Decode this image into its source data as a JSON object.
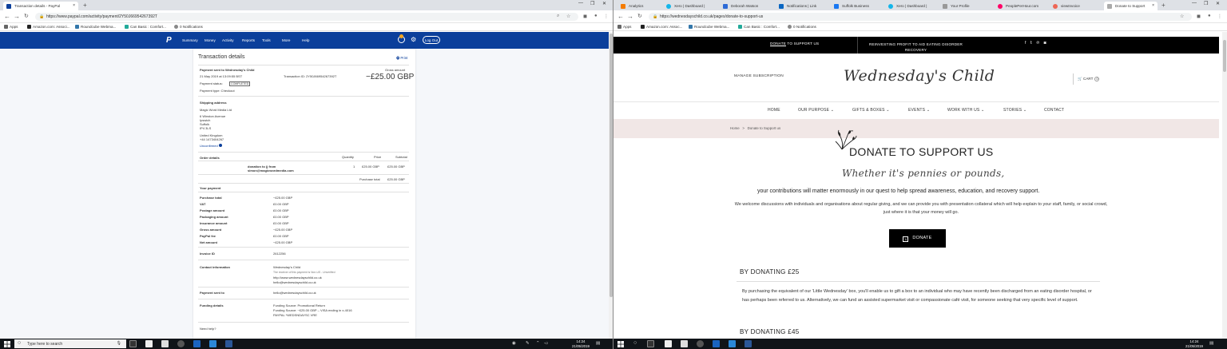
{
  "left_window": {
    "tabs": [
      {
        "title": "Transaction details - PayPal",
        "active": true
      }
    ],
    "url": "https://www.paypal.com/activity/payment/2Y50J66954267392T",
    "bookmarks": [
      "Apps",
      "Amazon.com: Associ...",
      "Roundcube Webma...",
      "Can Basic : Comfort...",
      "0 Notifications"
    ],
    "paypal": {
      "nav": [
        "Summary",
        "Money",
        "Activity",
        "Reports",
        "Tools",
        "More",
        "Help"
      ],
      "logout": "Log Out",
      "title": "Transaction details",
      "print": "Print",
      "payment_sent_to": "Payment sent to Wednesday's Child",
      "date": "21 May 2019 at 13:09:55 BST",
      "transaction_id": "Transaction ID: 2Y50J66954267392T",
      "gross_label": "Gross amount",
      "gross_amount": "−£25.00 GBP",
      "payment_status_label": "Payment status:",
      "payment_status": "COMPLETED",
      "payment_type": "Payment type: Checkout",
      "shipping_address_label": "Shipping address",
      "shipping_address": [
        "Magic Word Media Ltd",
        "6 Winston Avenue",
        "Ipswich",
        "Suffolk",
        "IP4 3LS",
        "United Kingdom",
        "+44 1473404267",
        "Unconfirmed"
      ],
      "order_details_label": "Order details",
      "order_headers": [
        "Quantity",
        "Price",
        "Subtotal"
      ],
      "order_item": [
        "donation to (j from",
        "simon@magicwordmedia.com"
      ],
      "order_qty": "1",
      "order_price": "£25.00 GBP",
      "order_subtotal": "£25.00 GBP",
      "purchase_total_label": "Purchase total",
      "purchase_total": "£25.00 GBP",
      "your_payment_label": "Your payment",
      "payment_rows": [
        {
          "label": "Purchase total",
          "value": "−£25.00 GBP"
        },
        {
          "label": "VAT",
          "value": "£0.00 GBP"
        },
        {
          "label": "Postage amount",
          "value": "£0.00 GBP"
        },
        {
          "label": "Packaging amount",
          "value": "£0.00 GBP"
        },
        {
          "label": "Insurance amount",
          "value": "£0.00 GBP"
        },
        {
          "label": "Gross amount",
          "value": "−£25.00 GBP"
        },
        {
          "label": "PayPal fee",
          "value": "£0.00 GBP"
        },
        {
          "label": "Net amount",
          "value": "−£25.00 GBP"
        }
      ],
      "invoice_label": "Invoice ID",
      "invoice_id": "2612256",
      "contact_label": "Contact information",
      "contact_lines": [
        "Wednesday's Child",
        "The receiver of this payment is Non-US - Unverified",
        "http://www.wednesdayschild.co.uk",
        "hello@wednesdayschild.co.uk"
      ],
      "sent_to_label": "Payment sent to",
      "sent_to": "hello@wednesdayschild.co.uk",
      "funding_label": "Funding details",
      "funding_lines": [
        "Funding Source: Promotional Return",
        "Funding Source: −£25.00 GBP – VISA ending in x-4016",
        "PAYPAL *WEDSNDAYSC VRE"
      ],
      "need_help": "Need help?"
    },
    "taskbar": {
      "search_placeholder": "Type here to search",
      "time": "14:24",
      "date": "21/05/2019"
    }
  },
  "right_window": {
    "tabs": [
      {
        "title": "Analytics"
      },
      {
        "title": "Xero | Dashboard |"
      },
      {
        "title": "Deborah Watson"
      },
      {
        "title": "Notifications | Link"
      },
      {
        "title": "Suffolk Business"
      },
      {
        "title": "Xero | Dashboard |"
      },
      {
        "title": "Your Profile"
      },
      {
        "title": "PeoplePerHour.com"
      },
      {
        "title": "viewInvoice"
      },
      {
        "title": "Donate to Support",
        "active": true
      }
    ],
    "url": "https://wednesdayschild.co.uk/pages/donate-to-support-us",
    "bookmarks": [
      "Apps",
      "Amazon.com: Assoc...",
      "Roundcube Webma...",
      "Can Basic : Comfort...",
      "0 Notifications"
    ],
    "site": {
      "topbar_donate": "DONATE",
      "topbar_donate_rest": " TO SUPPORT US",
      "topbar_mission": "REINVESTING PROFIT TO AID EATING DISORDER RECOVERY",
      "manage_subscription": "MANAGE SUBSCRIPTION",
      "logo": "Wednesday's Child",
      "cart": "CART",
      "cart_count": "0",
      "menu": [
        "HOME",
        "OUR PURPOSE",
        "GIFTS & BOXES",
        "EVENTS",
        "WORK WITH US",
        "STORIES",
        "CONTACT"
      ],
      "breadcrumb_home": "Home",
      "breadcrumb_sep": ">",
      "breadcrumb_current": "Donate to Support us",
      "heading": "DONATE TO SUPPORT US",
      "script_line": "Whether it's pennies or pounds,",
      "lead": "your contributions will matter enormously in our quest to help spread awareness, education, and recovery support.",
      "body": "We welcome discussions with individuals and organisations about regular giving, and we can provide you with presentation collateral which will help explain to your staff, family, or social crowd, just where it is that your money will go.",
      "donate_button": "DONATE",
      "tier1_heading": "BY DONATING £25",
      "tier1_text": "By purchasing the equivalent of our 'Little Wednesday' box, you'll enable us to gift a box to an individual who may have recently been discharged from an eating disorder hospital, or has perhaps been referred to us. Alternatively, we can fund an assisted supermarket visit or compassionate café visit, for someone seeking that very specific level of support.",
      "tier2_heading": "BY DONATING £45"
    },
    "taskbar": {
      "time": "14:24",
      "date": "21/05/2019"
    }
  }
}
